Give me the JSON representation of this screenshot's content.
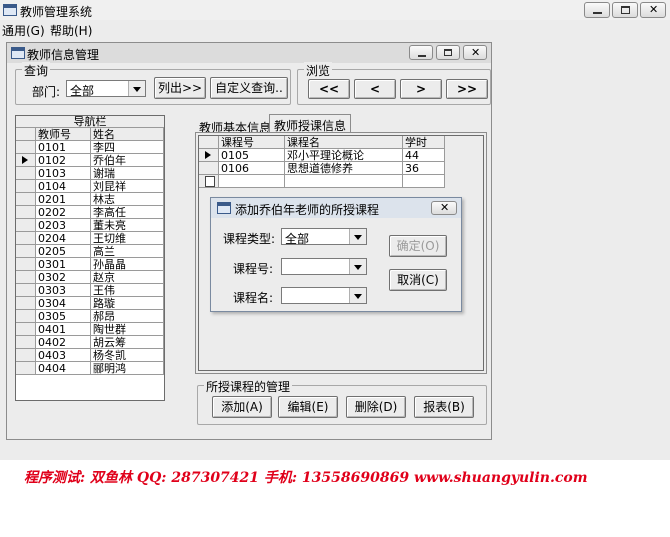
{
  "app": {
    "title": "教师管理系统",
    "menu": [
      "通用(G)",
      "帮助(H)"
    ],
    "controls": {
      "min": "▭",
      "max": "▢",
      "close": "✕"
    }
  },
  "child": {
    "title": "教师信息管理",
    "query": {
      "legend": "查询",
      "dept_label": "部门:",
      "dept_value": "全部",
      "list_button": "列出>>",
      "custom_button": "自定义查询.."
    },
    "browse": {
      "legend": "浏览",
      "buttons": [
        "<<",
        "<",
        ">",
        ">>"
      ]
    },
    "nav": {
      "caption": "导航栏",
      "headers": [
        "教师号",
        "姓名"
      ],
      "selected_index": 1,
      "rows": [
        [
          "0101",
          "李四"
        ],
        [
          "0102",
          "乔伯年"
        ],
        [
          "0103",
          "谢瑞"
        ],
        [
          "0104",
          "刘昆祥"
        ],
        [
          "0201",
          "林志"
        ],
        [
          "0202",
          "李高任"
        ],
        [
          "0203",
          "董未亮"
        ],
        [
          "0204",
          "王切维"
        ],
        [
          "0205",
          "高兰"
        ],
        [
          "0301",
          "孙晶晶"
        ],
        [
          "0302",
          "赵京"
        ],
        [
          "0303",
          "王伟"
        ],
        [
          "0304",
          "路璇"
        ],
        [
          "0305",
          "郝昂"
        ],
        [
          "0401",
          "陶世群"
        ],
        [
          "0402",
          "胡云筹"
        ],
        [
          "0403",
          "杨冬凯"
        ],
        [
          "0404",
          "郦明鸿"
        ]
      ]
    },
    "tabs": [
      "教师基本信息",
      "教师授课信息"
    ],
    "active_tab": 1,
    "course_grid": {
      "headers": [
        "课程号",
        "课程名",
        "学时"
      ],
      "rows": [
        [
          "0105",
          "邓小平理论概论",
          "44"
        ],
        [
          "0106",
          "思想道德修养",
          "36"
        ]
      ]
    },
    "manage": {
      "legend": "所授课程的管理",
      "buttons": [
        "添加(A)",
        "编辑(E)",
        "删除(D)",
        "报表(B)"
      ]
    }
  },
  "dialog": {
    "title": "添加乔伯年老师的所授课程",
    "type_label": "课程类型:",
    "type_value": "全部",
    "code_label": "课程号:",
    "code_value": "",
    "name_label": "课程名:",
    "name_value": "",
    "ok_button": "确定(O)",
    "cancel_button": "取消(C)"
  },
  "footer": {
    "text": "程序测试: 双鱼林   QQ: 287307421 手机: 13558690869   www.shuangyulin.com",
    "color": "#e0001a"
  }
}
